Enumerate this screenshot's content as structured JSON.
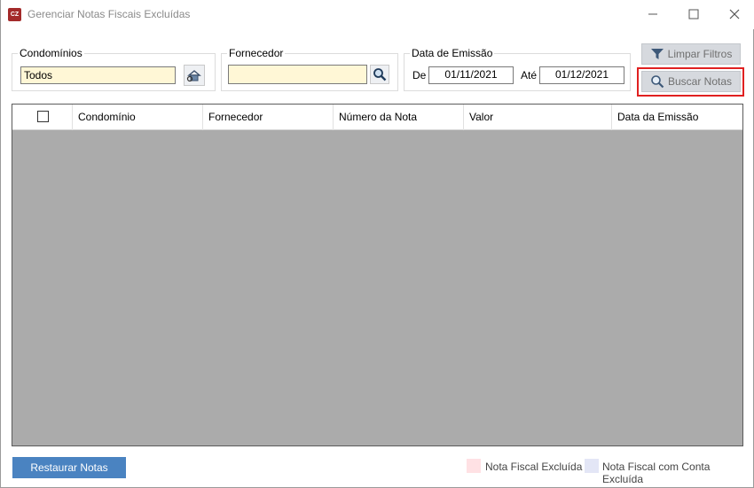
{
  "window": {
    "title": "Gerenciar Notas Fiscais Excluídas",
    "app_icon_text": "CZ"
  },
  "filters": {
    "condominios": {
      "label": "Condomínios",
      "value": "Todos"
    },
    "fornecedor": {
      "label": "Fornecedor",
      "value": ""
    },
    "data_emissao": {
      "label": "Data de Emissão",
      "de_label": "De",
      "de_value": "01/11/2021",
      "ate_label": "Até",
      "ate_value": "01/12/2021"
    },
    "limpar_label": "Limpar Filtros",
    "buscar_label": "Buscar Notas"
  },
  "grid": {
    "columns": [
      "Condomínio",
      "Fornecedor",
      "Número da Nota",
      "Valor",
      "Data da Emissão"
    ]
  },
  "footer": {
    "restaurar_label": "Restaurar Notas",
    "legend": [
      {
        "label": "Nota Fiscal Excluída",
        "color": "#ffe1e4"
      },
      {
        "label": "Nota Fiscal com Conta Excluída",
        "color": "#e3e6f6"
      }
    ]
  },
  "colors": {
    "accent_blue": "#4a83c1",
    "grid_background": "#ababab",
    "input_background": "#fff7d6",
    "highlight_red": "#e02020"
  }
}
